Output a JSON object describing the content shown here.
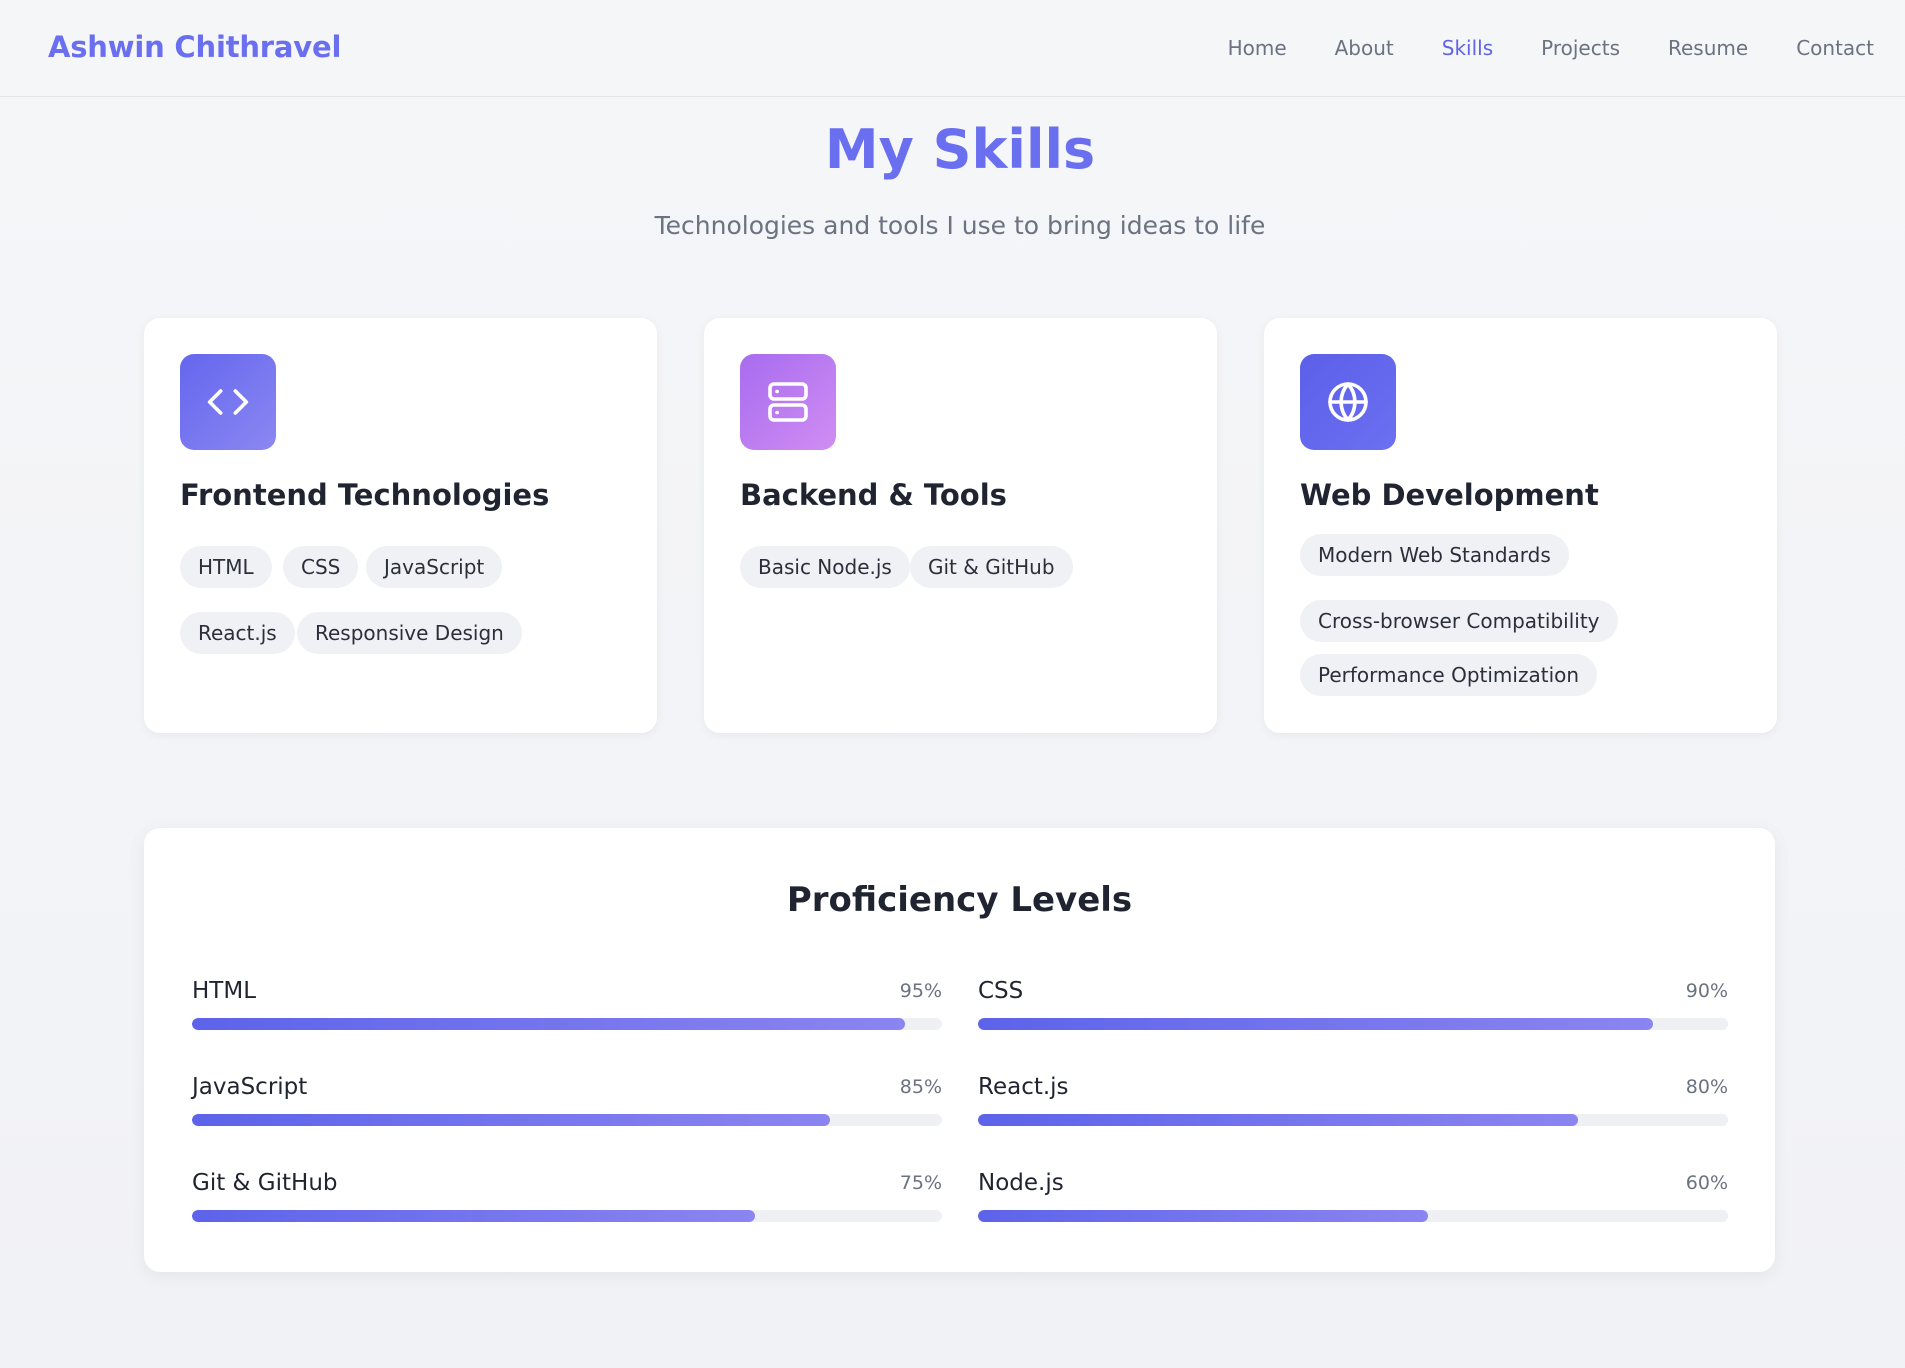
{
  "nav": {
    "brand": "Ashwin Chithravel",
    "links": [
      "Home",
      "About",
      "Skills",
      "Projects",
      "Resume",
      "Contact"
    ],
    "active": "Skills"
  },
  "header": {
    "title": "My Skills",
    "subtitle": "Technologies and tools I use to bring ideas to life"
  },
  "cards": [
    {
      "icon": "code-icon",
      "title": "Frontend Technologies",
      "tags": [
        "HTML",
        "CSS",
        "JavaScript",
        "React.js",
        "Responsive Design"
      ]
    },
    {
      "icon": "server-icon",
      "title": "Backend & Tools",
      "tags": [
        "Basic Node.js",
        "Git & GitHub"
      ]
    },
    {
      "icon": "globe-icon",
      "title": "Web Development",
      "tags": [
        "Modern Web Standards",
        "Cross-browser Compatibility",
        "Performance Optimization"
      ]
    }
  ],
  "proficiency": {
    "title": "Proficiency Levels",
    "skills": [
      {
        "name": "HTML",
        "percent_label": "95%",
        "level": 95
      },
      {
        "name": "CSS",
        "percent_label": "90%",
        "level": 90
      },
      {
        "name": "JavaScript",
        "percent_label": "85%",
        "level": 85
      },
      {
        "name": "React.js",
        "percent_label": "80%",
        "level": 80
      },
      {
        "name": "Git & GitHub",
        "percent_label": "75%",
        "level": 75
      },
      {
        "name": "Node.js",
        "percent_label": "60%",
        "level": 60
      }
    ]
  },
  "colors": {
    "accent": "#6a6ff0",
    "card_icon_1": "#6d6ff0",
    "card_icon_2": "#c17ef0",
    "card_icon_3": "#5d63ea"
  }
}
